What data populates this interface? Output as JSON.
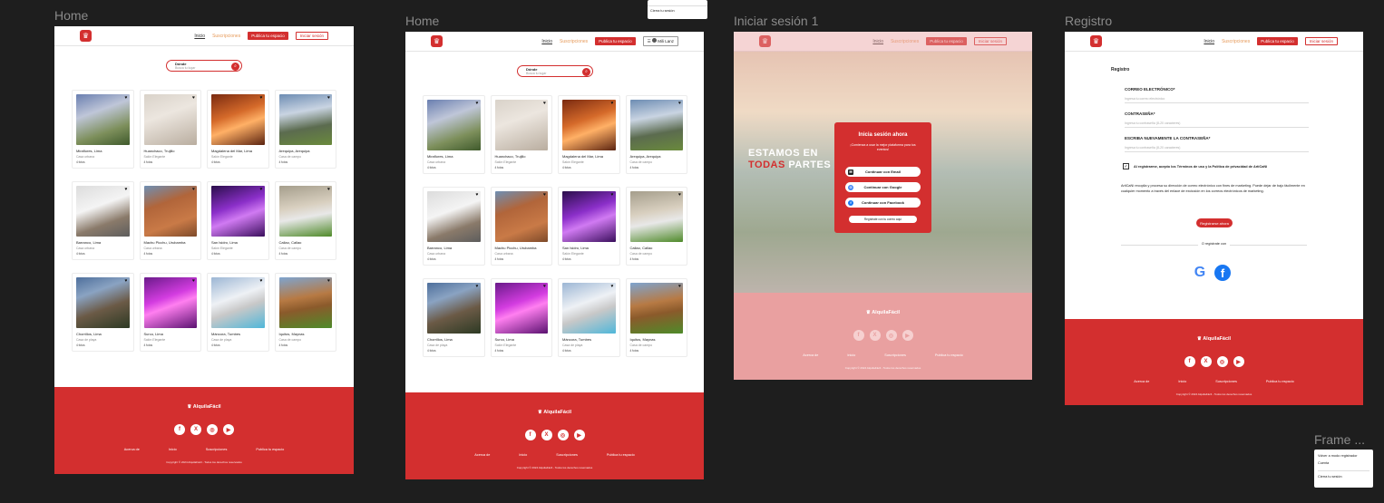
{
  "frames": {
    "home1": {
      "label": "Home"
    },
    "home2": {
      "label": "Home"
    },
    "login": {
      "label": "Iniciar sesión 1"
    },
    "register": {
      "label": "Registro"
    },
    "frame_small": {
      "label": "Frame ..."
    }
  },
  "header": {
    "home": "Inicio",
    "subs": "Suscripciones",
    "publish": "Publica tu espacio",
    "login": "Iniciar sesión",
    "user": "Mili Lanz"
  },
  "search": {
    "label": "Dónde",
    "placeholder": "Busca tu lugar"
  },
  "cards1": [
    {
      "title": "Miraflores, Lima",
      "type": "Casa urbana",
      "meta": "4 fotos"
    },
    {
      "title": "Huanchaco, Trujillo",
      "type": "Salón Elegante",
      "meta": "4 fotos"
    },
    {
      "title": "Magdalena del Mar, Lima",
      "type": "Salón Elegante",
      "meta": "4 fotos"
    },
    {
      "title": "Arequipa, Arequipa",
      "type": "Casa de campo",
      "meta": "4 fotos"
    },
    {
      "title": "Barranco, Lima",
      "type": "Casa urbana",
      "meta": "4 fotos"
    },
    {
      "title": "Machu Picchu, Urubamba",
      "type": "Casa urbana",
      "meta": "4 fotos"
    },
    {
      "title": "San Isidro, Lima",
      "type": "Salón Elegante",
      "meta": "4 fotos"
    },
    {
      "title": "Callao, Callao",
      "type": "Casa de campo",
      "meta": "4 fotos"
    },
    {
      "title": "Chorrillos, Lima",
      "type": "Casa de playa",
      "meta": "4 fotos"
    },
    {
      "title": "Surco, Lima",
      "type": "Salón Elegante",
      "meta": "4 fotos"
    },
    {
      "title": "Máncora, Tumbes",
      "type": "Casa de playa",
      "meta": "4 fotos"
    },
    {
      "title": "Iquitos, Maynas",
      "type": "Casa de campo",
      "meta": "4 fotos"
    }
  ],
  "cards2": [
    {
      "title": "Miraflores, Lima",
      "type": "Casa urbana",
      "meta": "4 fotos"
    },
    {
      "title": "Huanchaco, Trujillo",
      "type": "Salón Elegante",
      "meta": "4 fotos"
    },
    {
      "title": "Magdalena del Mar, Lima",
      "type": "Salón Elegante",
      "meta": "4 fotos"
    },
    {
      "title": "Arequipa, Arequipa",
      "type": "Casa de campo",
      "meta": "4 fotos"
    },
    {
      "title": "Barranco, Lima",
      "type": "Casa urbana",
      "meta": "4 fotos"
    },
    {
      "title": "Machu Picchu, Urubamba",
      "type": "Casa urbana",
      "meta": "4 fotos"
    },
    {
      "title": "San Isidro, Lima",
      "type": "Salón Elegante",
      "meta": "4 fotos"
    },
    {
      "title": "Callao, Callao",
      "type": "Casa de campo",
      "meta": "4 fotos"
    },
    {
      "title": "Chorrillos, Lima",
      "type": "Casa de playa",
      "meta": "4 fotos"
    },
    {
      "title": "Surco, Lima",
      "type": "Salón Elegante",
      "meta": "4 fotos"
    },
    {
      "title": "Máncora, Tumbes",
      "type": "Casa de playa",
      "meta": "4 fotos"
    },
    {
      "title": "Iquitos, Maynas",
      "type": "Casa de campo",
      "meta": "4 fotos"
    }
  ],
  "footer": {
    "brand": "AlquilaFácil",
    "links": [
      "Acerca de",
      "Inicio",
      "Suscripciones",
      "Publica tu espacio"
    ],
    "copy": "Copyright © 2024 AlquilaFácil - Todos los derechos reservados"
  },
  "login": {
    "hero_line1": "ESTAMOS EN",
    "hero_accent": "TODAS",
    "hero_rest": "PARTES",
    "title": "Inicia sesión ahora",
    "subtitle": "¡Comienza a usar la mejor plataforma para tus eventos!",
    "btn_email": "Continuar con Email",
    "btn_google": "Continuar con Google",
    "btn_facebook": "Continuar con Facebook",
    "register": "Regístrate con tu correo aquí"
  },
  "register": {
    "heading": "Registro",
    "email_label": "CORREO ELECTRÓNICO*",
    "email_ph": "Ingresa tu correo electrónico",
    "pass_label": "CONTRASEÑA*",
    "pass_ph": "Ingresa tu contraseña (8-20 caracteres)",
    "pass2_label": "ESCRIBA NUEVAMENTE LA CONTRASEÑA*",
    "pass2_ph": "Ingresa tu contraseña (8-20 caracteres)",
    "terms": "Al registrarme, acepto los Términos de uso y la Política de privacidad de ArtiCaNi",
    "privacy": "ArtiCaNi recopila y procesa su dirección de correo electrónico con fines de marketing. Puede dejar de bajo fácilmente en cualquier momento a través del enlace de exclusión en los correos electrónicos de marketing.",
    "submit": "Registrarse ahora",
    "or": "O regístrate con"
  },
  "menu_top": {
    "item": "Cierra tu sesión"
  },
  "menu_small": {
    "item1": "Volver a modo registrador",
    "item2": "Cuenta",
    "item3": "Cierra tu sesión"
  }
}
